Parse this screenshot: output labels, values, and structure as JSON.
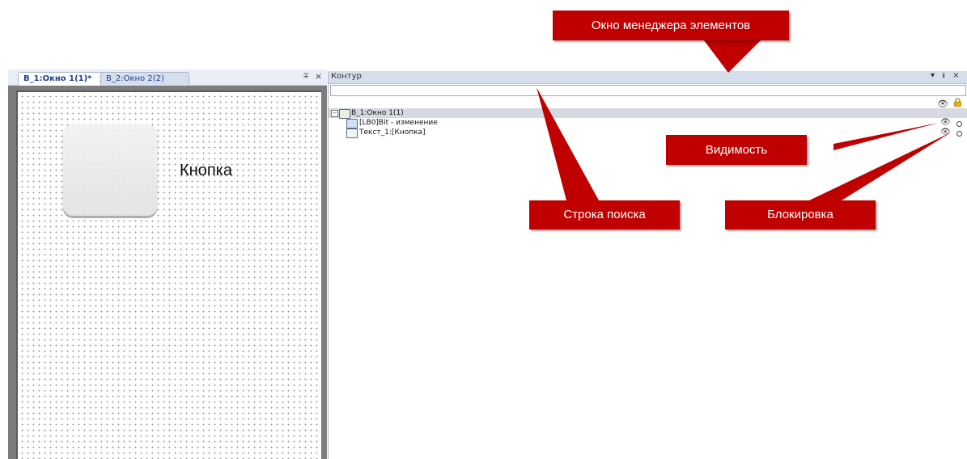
{
  "editor": {
    "tabs": [
      {
        "label": "B_1:Окно 1(1)*",
        "close": "×"
      },
      {
        "label": "B_2:Окно 2(2)"
      }
    ],
    "pin": "∓",
    "close": "×",
    "button_text": "Кнопка"
  },
  "outline": {
    "title": "Контур",
    "header_buttons": "▾ ᵻ ×",
    "search": {
      "value": "",
      "placeholder": ""
    },
    "tree": [
      {
        "label": "B_1:Окно 1(1)",
        "expander": "−"
      },
      {
        "label": "[LB0]Bit - изменение"
      },
      {
        "label": "Текст_1:[Кнопка]"
      }
    ]
  },
  "callouts": {
    "manager": "Окно менеджера элементов",
    "visibility": "Видимость",
    "search": "Строка поиска",
    "lock": "Блокировка"
  },
  "icons": {
    "eye": "👁"
  },
  "colors": {
    "callout": "#c00000",
    "tab_text": "#1d3f8f",
    "panel_header": "#d5deec"
  }
}
